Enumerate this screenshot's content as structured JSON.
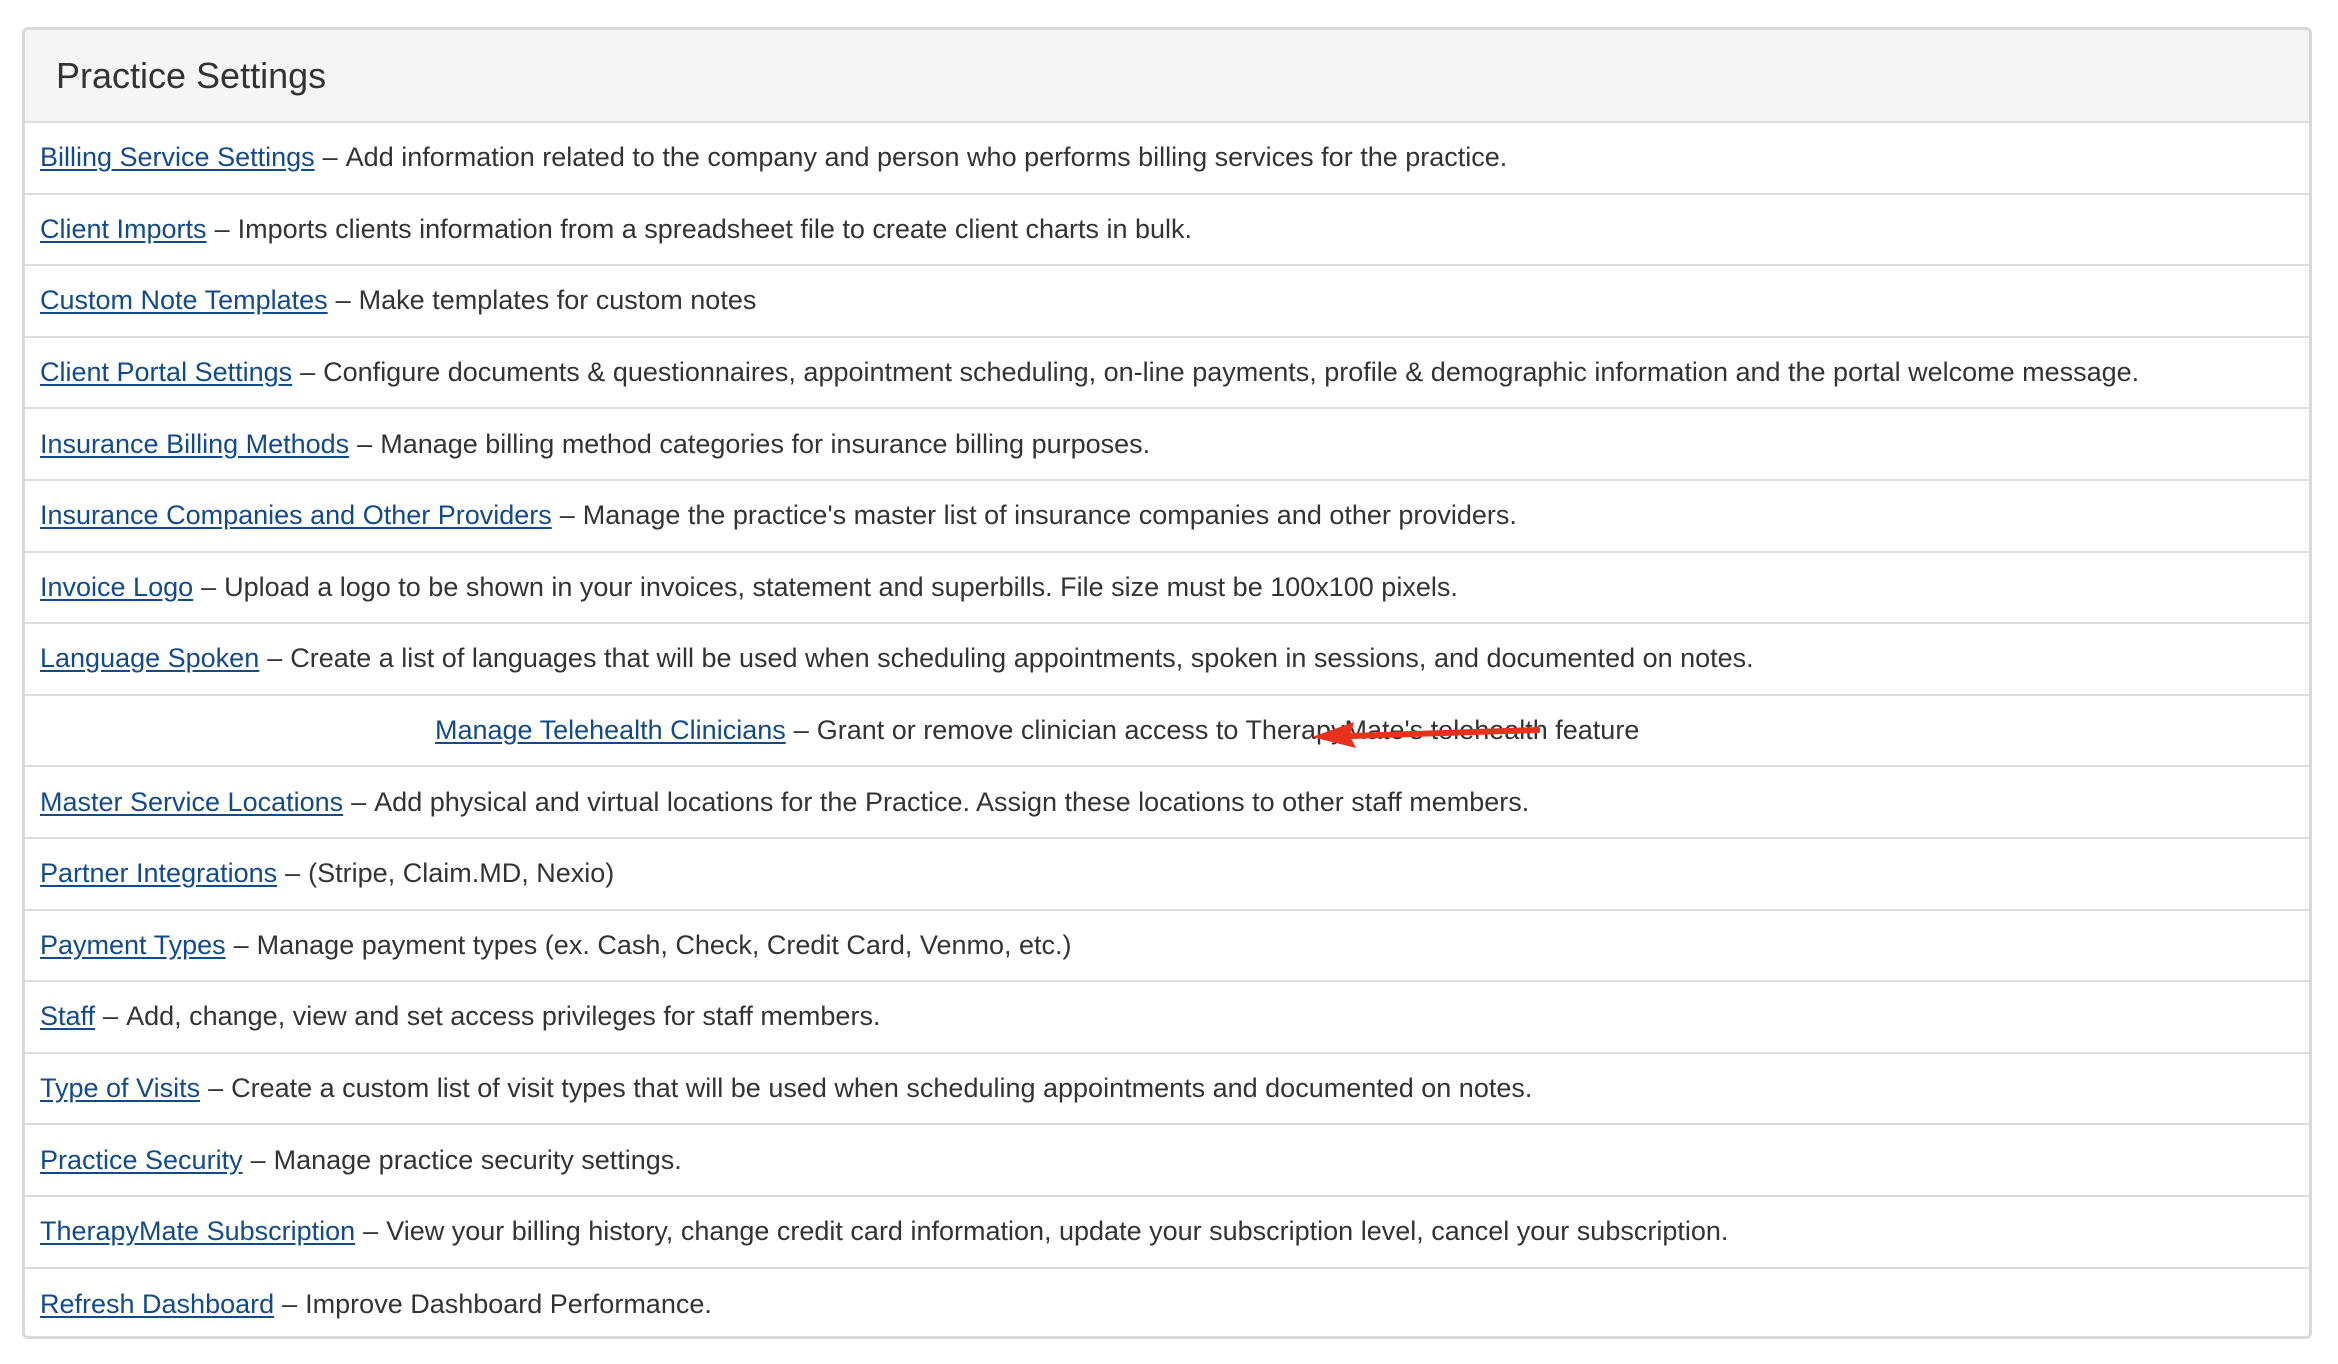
{
  "panel": {
    "title": "Practice Settings"
  },
  "separator": "–",
  "items": [
    {
      "label": "Billing Service Settings",
      "desc": "Add information related to the company and person who performs billing services for the practice."
    },
    {
      "label": "Client Imports",
      "desc": "Imports clients information from a spreadsheet file to create client charts in bulk."
    },
    {
      "label": "Custom Note Templates",
      "desc": "Make templates for custom notes"
    },
    {
      "label": "Client Portal Settings",
      "desc": "Configure documents & questionnaires, appointment scheduling, on-line payments, profile & demographic information and the portal welcome message."
    },
    {
      "label": "Insurance Billing Methods",
      "desc": "Manage billing method categories for insurance billing purposes."
    },
    {
      "label": "Insurance Companies and Other Providers",
      "desc": "Manage the practice's master list of insurance companies and other providers."
    },
    {
      "label": "Invoice Logo",
      "desc": "Upload a logo to be shown in your invoices, statement and superbills. File size must be 100x100 pixels."
    },
    {
      "label": "Language Spoken",
      "desc": "Create a list of languages that will be used when scheduling appointments, spoken in sessions, and documented on notes."
    },
    {
      "label": "Manage Telehealth Clinicians",
      "desc": "Grant or remove clinician access to TherapyMate's telehealth feature",
      "highlighted": true
    },
    {
      "label": "Master Service Locations",
      "desc": "Add physical and virtual locations for the Practice. Assign these locations to other staff members."
    },
    {
      "label": "Partner Integrations",
      "desc": "(Stripe, Claim.MD, Nexio)"
    },
    {
      "label": "Payment Types",
      "desc": "Manage payment types (ex. Cash, Check, Credit Card, Venmo, etc.)"
    },
    {
      "label": "Staff",
      "desc": "Add, change, view and set access privileges for staff members."
    },
    {
      "label": "Type of Visits",
      "desc": "Create a custom list of visit types that will be used when scheduling appointments and documented on notes."
    },
    {
      "label": "Practice Security",
      "desc": "Manage practice security settings."
    },
    {
      "label": "TherapyMate Subscription",
      "desc": "View your billing history, change credit card information, update your subscription level, cancel your subscription."
    },
    {
      "label": "Refresh Dashboard",
      "desc": "Improve Dashboard Performance."
    }
  ],
  "colors": {
    "link": "#134a8a",
    "highlight": "#f8f87c",
    "arrow": "#e8321e"
  },
  "icons": {
    "annotation": "arrow-left-icon"
  }
}
